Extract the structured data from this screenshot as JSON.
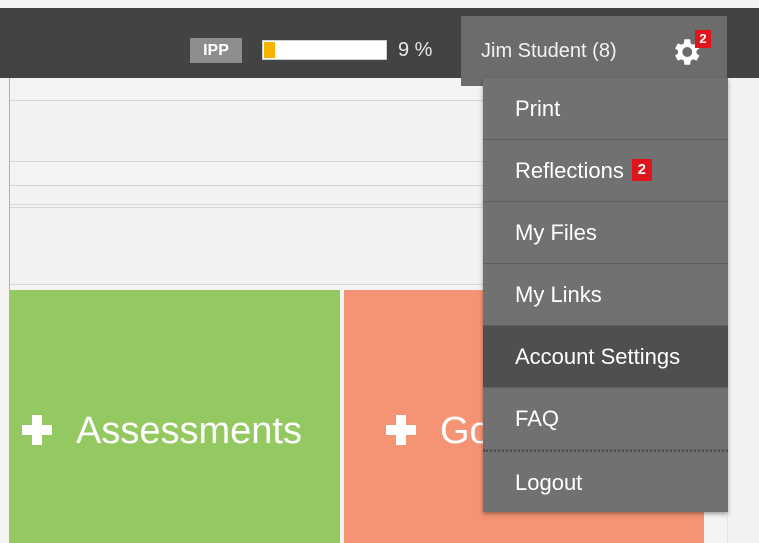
{
  "header": {
    "badge_label": "IPP",
    "progress_percent": 9,
    "progress_text": "9 %",
    "user_name": "Jim Student (8)",
    "notification_count": "2",
    "gear_icon": "gear-icon"
  },
  "tiles": [
    {
      "label": "Assessments",
      "color": "#94c860",
      "icon": "plus-icon"
    },
    {
      "label": "Go",
      "color": "#f49474",
      "icon": "plus-icon"
    }
  ],
  "menu": {
    "items": [
      {
        "label": "Print"
      },
      {
        "label": "Reflections",
        "badge": "2"
      },
      {
        "label": "My Files"
      },
      {
        "label": "My Links"
      },
      {
        "label": "Account Settings",
        "active": true
      },
      {
        "label": "FAQ"
      },
      {
        "label": "Logout"
      }
    ]
  },
  "colors": {
    "topbar": "#434343",
    "user_tab": "#6c6c6c",
    "menu_bg": "#717171",
    "menu_active": "#4f4f4f",
    "progress_fill": "#f6b400",
    "notification": "#e0141c"
  }
}
